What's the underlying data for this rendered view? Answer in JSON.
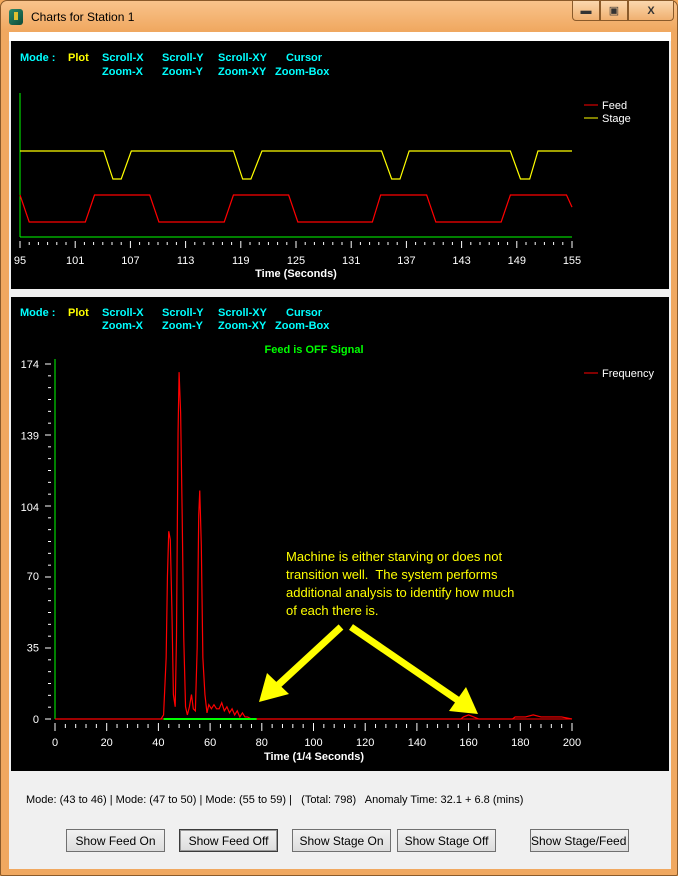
{
  "window": {
    "title": "Charts for Station 1",
    "minimize": "▬",
    "maximize": "▣",
    "close": "X"
  },
  "mode_bar": {
    "label": "Mode :",
    "plot": "Plot",
    "scroll_x": "Scroll-X",
    "scroll_y": "Scroll-Y",
    "scroll_xy": "Scroll-XY",
    "cursor": "Cursor",
    "zoom_x": "Zoom-X",
    "zoom_y": "Zoom-Y",
    "zoom_xy": "Zoom-XY",
    "zoom_box": "Zoom-Box"
  },
  "colors": {
    "mode_text": "#00ffff",
    "active_mode": "#ffff00",
    "axis": "#00ff00",
    "feed": "#ff0000",
    "stage": "#ffff00",
    "annotation": "#ffff00"
  },
  "chart_data": [
    {
      "type": "line",
      "title": "",
      "xlabel": "Time (Seconds)",
      "ylabel": "",
      "xlim": [
        95,
        155
      ],
      "x_ticks": [
        "95",
        "101",
        "107",
        "113",
        "119",
        "125",
        "131",
        "137",
        "143",
        "149",
        "155"
      ],
      "legend": "top-right",
      "series": [
        {
          "name": "Feed",
          "color": "#ff0000",
          "levels": "1 = high, 0 = low",
          "points": [
            [
              95,
              1
            ],
            [
              96,
              0
            ],
            [
              102.1,
              0
            ],
            [
              103.1,
              1
            ],
            [
              109.1,
              1
            ],
            [
              110.1,
              0
            ],
            [
              117.2,
              0
            ],
            [
              118.2,
              1
            ],
            [
              124.2,
              1
            ],
            [
              125.2,
              0
            ],
            [
              133.3,
              0
            ],
            [
              134.2,
              1
            ],
            [
              139.2,
              1
            ],
            [
              140.2,
              0
            ],
            [
              147.3,
              0
            ],
            [
              148.3,
              1
            ],
            [
              154.4,
              1
            ],
            [
              155,
              0.55
            ]
          ]
        },
        {
          "name": "Stage",
          "color": "#ffff00",
          "points": [
            [
              95,
              1
            ],
            [
              104.1,
              1
            ],
            [
              105.1,
              0
            ],
            [
              106,
              0
            ],
            [
              107.1,
              1
            ],
            [
              118.2,
              1
            ],
            [
              119.2,
              0
            ],
            [
              120.1,
              0
            ],
            [
              121.3,
              1
            ],
            [
              134.3,
              1
            ],
            [
              135.4,
              0
            ],
            [
              136.3,
              0
            ],
            [
              137.3,
              1
            ],
            [
              148.3,
              1
            ],
            [
              149.4,
              0
            ],
            [
              150.4,
              0
            ],
            [
              151.3,
              1
            ],
            [
              155,
              1
            ]
          ]
        }
      ]
    },
    {
      "type": "line",
      "title": "Feed is OFF Signal",
      "xlabel": "Time (1/4 Seconds)",
      "ylabel": "",
      "xlim": [
        0,
        200
      ],
      "ylim": [
        0,
        174
      ],
      "x_ticks": [
        "0",
        "20",
        "40",
        "60",
        "80",
        "100",
        "120",
        "140",
        "160",
        "180",
        "200"
      ],
      "y_ticks": [
        "0",
        "35",
        "70",
        "104",
        "139",
        "174"
      ],
      "legend": "top-right",
      "series": [
        {
          "name": "Frequency",
          "color": "#ff0000",
          "points": [
            [
              0,
              0
            ],
            [
              41,
              0
            ],
            [
              42,
              2
            ],
            [
              43,
              30
            ],
            [
              43.5,
              70
            ],
            [
              44,
              92
            ],
            [
              44.6,
              88
            ],
            [
              45.2,
              55
            ],
            [
              45.8,
              12
            ],
            [
              46.5,
              6
            ],
            [
              47,
              40
            ],
            [
              47.6,
              140
            ],
            [
              48,
              170
            ],
            [
              48.6,
              150
            ],
            [
              49.2,
              100
            ],
            [
              49.8,
              40
            ],
            [
              50.5,
              6
            ],
            [
              51.2,
              2
            ],
            [
              52,
              6
            ],
            [
              52.8,
              12
            ],
            [
              53.5,
              5
            ],
            [
              54.3,
              4
            ],
            [
              55,
              35
            ],
            [
              55.6,
              100
            ],
            [
              56,
              112
            ],
            [
              56.6,
              85
            ],
            [
              57.2,
              30
            ],
            [
              58,
              12
            ],
            [
              58.8,
              3
            ],
            [
              59.5,
              7
            ],
            [
              60.5,
              5
            ],
            [
              61.5,
              7
            ],
            [
              62.5,
              5
            ],
            [
              63.5,
              5
            ],
            [
              64.5,
              8
            ],
            [
              65.5,
              4
            ],
            [
              66.5,
              6
            ],
            [
              67.5,
              3
            ],
            [
              68.5,
              5
            ],
            [
              69.5,
              2
            ],
            [
              70.5,
              4
            ],
            [
              71.5,
              1
            ],
            [
              72.5,
              3
            ],
            [
              73.5,
              1
            ],
            [
              74.5,
              1
            ],
            [
              76,
              0
            ],
            [
              157,
              0
            ],
            [
              158,
              1
            ],
            [
              160,
              2
            ],
            [
              162,
              1
            ],
            [
              164,
              0
            ],
            [
              177,
              0
            ],
            [
              178,
              1
            ],
            [
              182,
              1
            ],
            [
              185,
              2
            ],
            [
              188,
              1
            ],
            [
              192,
              1
            ],
            [
              196,
              1
            ],
            [
              200,
              0
            ]
          ]
        },
        {
          "color": "#00ff00",
          "points": [
            [
              42,
              0
            ],
            [
              78,
              0
            ]
          ]
        }
      ]
    }
  ],
  "annotation": {
    "lines": [
      "Machine is either starving or does not",
      "transition well.  The system performs",
      "additional analysis to identify how much",
      "of each there is."
    ]
  },
  "status_text": "Mode: (43 to 46) | Mode: (47 to 50) | Mode: (55 to 59) |   (Total: 798)   Anomaly Time: 32.1 + 6.8 (mins)",
  "buttons": {
    "feed_on": "Show Feed On",
    "feed_off": "Show Feed Off",
    "stage_on": "Show Stage On",
    "stage_off": "Show Stage Off",
    "stage_feed": "Show Stage/Feed O"
  }
}
